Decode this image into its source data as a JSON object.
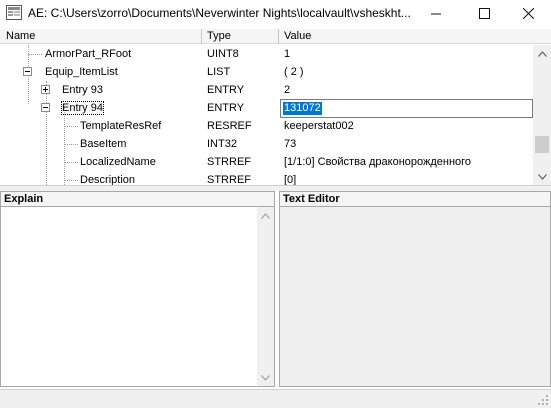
{
  "window": {
    "title": "AE: C:\\Users\\zorro\\Documents\\Neverwinter Nights\\localvault\\vsheskht...",
    "icon": "app-icon"
  },
  "grid": {
    "columns": [
      "Name",
      "Type",
      "Value"
    ],
    "rows": [
      {
        "name": "ArmorPart_RFoot",
        "type": "UINT8",
        "value": "1"
      },
      {
        "name": "Equip_ItemList",
        "type": "LIST",
        "value": "( 2 )"
      },
      {
        "name": "Entry 93",
        "type": "ENTRY",
        "value": "2"
      },
      {
        "name": "Entry 94",
        "type": "ENTRY",
        "value": "131072"
      },
      {
        "name": "TemplateResRef",
        "type": "RESREF",
        "value": "keeperstat002"
      },
      {
        "name": "BaseItem",
        "type": "INT32",
        "value": "73"
      },
      {
        "name": "LocalizedName",
        "type": "STRREF",
        "value": "[1/1:0]  Свойства драконорожденного"
      },
      {
        "name": "Description",
        "type": "STRREF",
        "value": "[0]"
      }
    ],
    "editing_value": "131072"
  },
  "panes": {
    "explain_title": "Explain",
    "text_editor_title": "Text Editor"
  }
}
